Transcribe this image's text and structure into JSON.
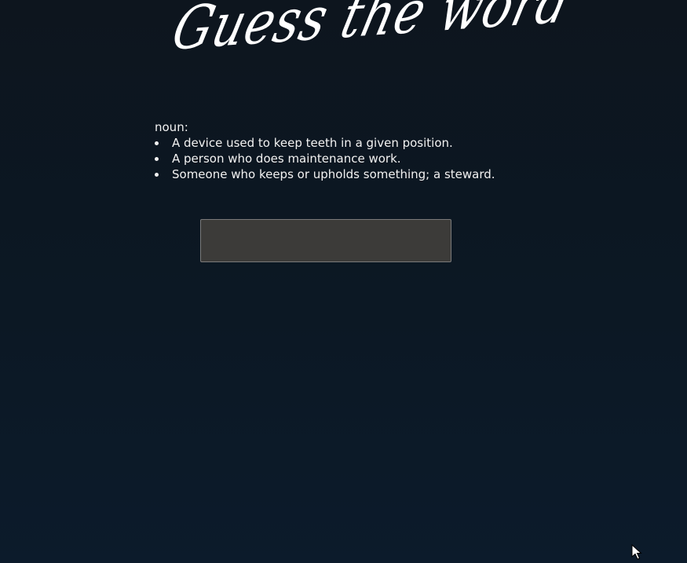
{
  "header": {
    "title": "Guess the word"
  },
  "definition": {
    "part_of_speech": "noun:",
    "items": [
      "A device used to keep teeth in a given position.",
      "A person who does maintenance work.",
      "Someone who keeps or upholds something; a steward."
    ]
  },
  "guess": {
    "value": "",
    "placeholder": ""
  },
  "colors": {
    "background_top": "#0d151e",
    "background_bottom": "#0c1b2b",
    "input_background": "#3c3b39",
    "input_border": "#7a7a7a",
    "text": "#ffffff"
  },
  "icons": {
    "pointer": "mouse-pointer-icon"
  }
}
